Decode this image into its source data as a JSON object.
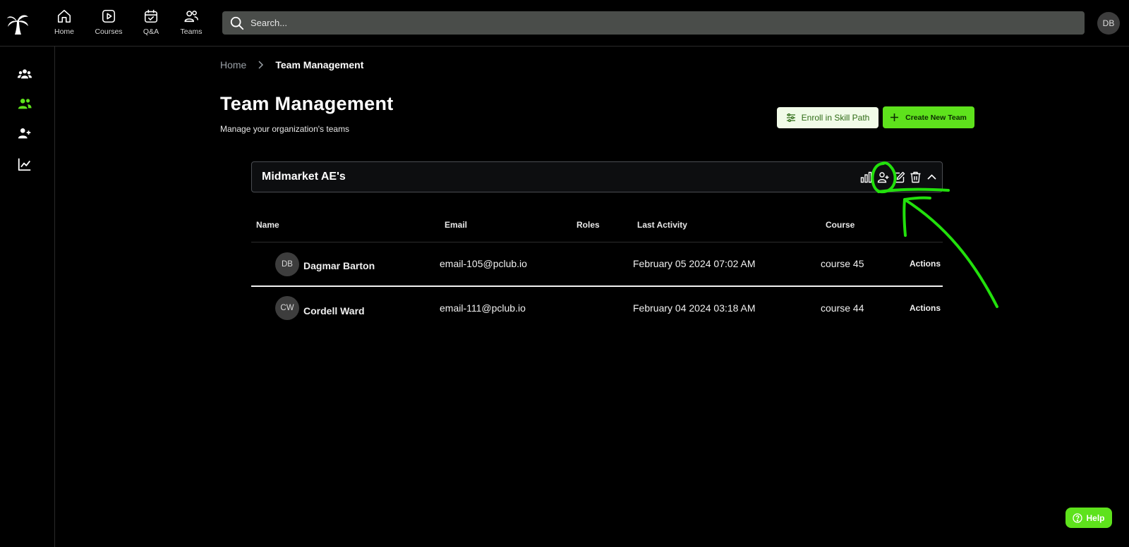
{
  "nav": {
    "items": [
      {
        "label": "Home",
        "icon": "home-icon"
      },
      {
        "label": "Courses",
        "icon": "play-square-icon"
      },
      {
        "label": "Q&A",
        "icon": "calendar-check-icon"
      },
      {
        "label": "Teams",
        "icon": "users-icon"
      }
    ],
    "search_placeholder": "Search...",
    "user_initials": "DB"
  },
  "sidebar": {
    "items": [
      {
        "icon": "team-group-icon",
        "active": false
      },
      {
        "icon": "users-icon",
        "active": true
      },
      {
        "icon": "user-plus-icon",
        "active": false
      },
      {
        "icon": "line-chart-icon",
        "active": false
      }
    ]
  },
  "breadcrumb": {
    "home": "Home",
    "current": "Team Management"
  },
  "page": {
    "title": "Team Management",
    "subtitle": "Manage your organization's teams"
  },
  "buttons": {
    "enroll": "Enroll in Skill Path",
    "create": "Create New Team"
  },
  "team": {
    "name": "Midmarket AE's",
    "icons": [
      "bar-chart-icon",
      "add-member-icon",
      "edit-icon",
      "trash-icon",
      "chevron-up-icon"
    ]
  },
  "table": {
    "headers": [
      "Name",
      "Email",
      "Roles",
      "Last Activity",
      "Course"
    ],
    "rows": [
      {
        "initials": "DB",
        "name": "Dagmar Barton",
        "email": "email-105@pclub.io",
        "roles": "",
        "last_activity": "February 05 2024 07:02 AM",
        "course": "course 45",
        "actions": "Actions"
      },
      {
        "initials": "CW",
        "name": "Cordell Ward",
        "email": "email-111@pclub.io",
        "roles": "",
        "last_activity": "February 04 2024 03:18 AM",
        "course": "course 44",
        "actions": "Actions"
      }
    ]
  },
  "help": {
    "label": "Help"
  },
  "colors": {
    "accent": "#5ee21c",
    "background": "#000000",
    "search_bg": "#4a4d4a",
    "annotation": "#22e00c"
  }
}
